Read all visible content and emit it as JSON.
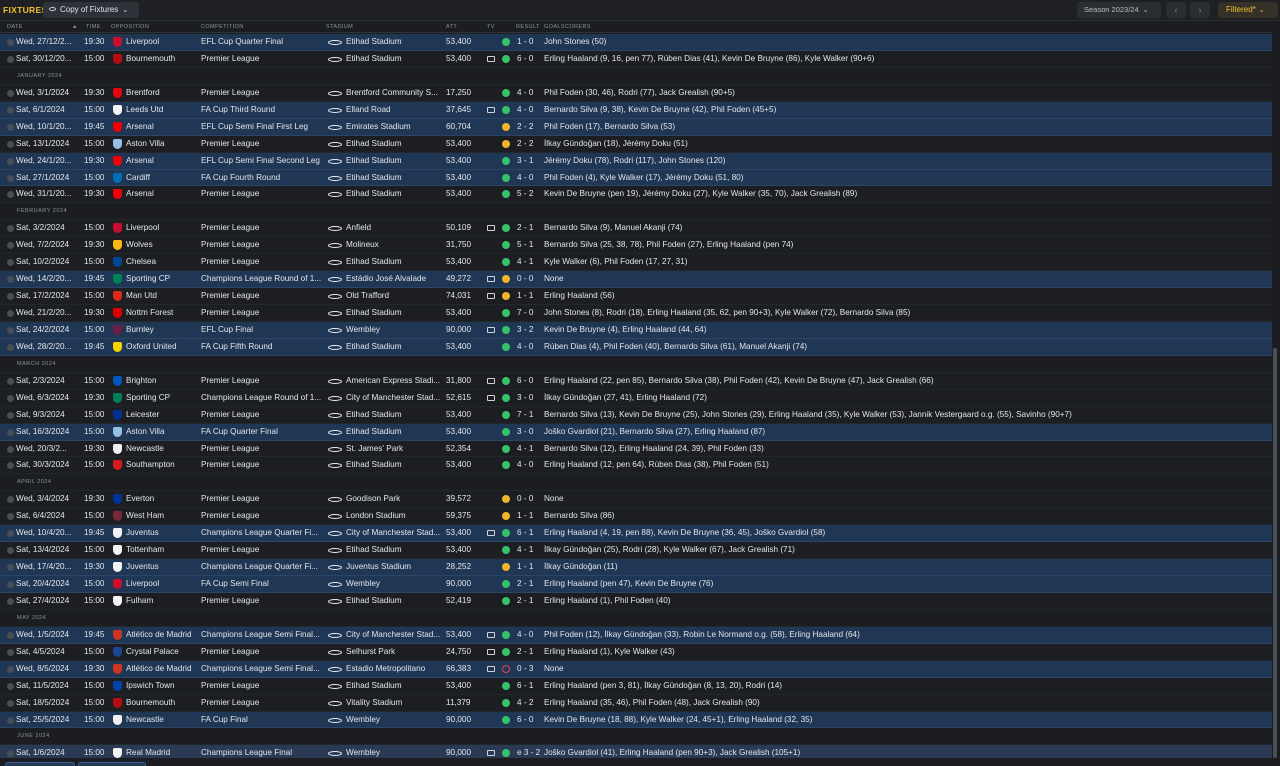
{
  "header": {
    "title": "FIXTURES",
    "view_label": "Copy of Fixtures",
    "season_label": "Season 2023/24",
    "filter_label": "Filtered*",
    "prev_icon": "chevron-left-icon",
    "next_icon": "chevron-right-icon"
  },
  "columns": {
    "date": "DATE",
    "time": "TIME",
    "opposition": "OPPOSITION",
    "competition": "COMPETITION",
    "stadium": "STADIUM",
    "att": "ATT",
    "tv": "TV",
    "result": "RESULT",
    "goalscorers": "GOALSCORERS"
  },
  "colors": {
    "accent": "#f0c030",
    "home_row": "#1f3654",
    "win": "#35c26a",
    "draw": "#f0b52c",
    "loss": "#e04848"
  },
  "rows": [
    {
      "kind": "fixture",
      "venue": "home",
      "date": "Wed, 27/12/2...",
      "time": "19:30",
      "opp": "Liverpool",
      "crest": "#c8102e",
      "comp": "EFL Cup Quarter Final",
      "stadium": "Etihad Stadium",
      "att": "53,400",
      "tv": false,
      "res": "w",
      "score": "1 - 0",
      "scorers": "John Stones (50)"
    },
    {
      "kind": "fixture",
      "venue": "away",
      "date": "Sat, 30/12/20...",
      "time": "15:00",
      "opp": "Bournemouth",
      "crest": "#b50e12",
      "comp": "Premier League",
      "stadium": "Etihad Stadium",
      "att": "53,400",
      "tv": true,
      "res": "w",
      "score": "6 - 0",
      "scorers": "Erling Haaland (9, 16, pen 77), Rúben Dias (41), Kevin De Bruyne (86), Kyle Walker (90+6)"
    },
    {
      "kind": "month",
      "label": "JANUARY 2024"
    },
    {
      "kind": "fixture",
      "venue": "away",
      "date": "Wed, 3/1/2024",
      "time": "19:30",
      "opp": "Brentford",
      "crest": "#e30613",
      "comp": "Premier League",
      "stadium": "Brentford Community S...",
      "att": "17,250",
      "tv": false,
      "res": "w",
      "score": "4 - 0",
      "scorers": "Phil Foden (30, 46), Rodri (77), Jack Grealish (90+5)"
    },
    {
      "kind": "fixture",
      "venue": "home",
      "date": "Sat, 6/1/2024",
      "time": "15:00",
      "opp": "Leeds Utd",
      "crest": "#f5f5f5",
      "comp": "FA Cup Third Round",
      "stadium": "Elland Road",
      "att": "37,645",
      "tv": true,
      "res": "w",
      "score": "4 - 0",
      "scorers": "Bernardo Silva (9, 38), Kevin De Bruyne (42), Phil Foden (45+5)"
    },
    {
      "kind": "fixture",
      "venue": "home",
      "date": "Wed, 10/1/20...",
      "time": "19:45",
      "opp": "Arsenal",
      "crest": "#ef0107",
      "comp": "EFL Cup Semi Final First Leg",
      "stadium": "Emirates Stadium",
      "att": "60,704",
      "tv": false,
      "res": "d",
      "score": "2 - 2",
      "scorers": "Phil Foden (17), Bernardo Silva (53)"
    },
    {
      "kind": "fixture",
      "venue": "away",
      "date": "Sat, 13/1/2024",
      "time": "15:00",
      "opp": "Aston Villa",
      "crest": "#95bfe5",
      "comp": "Premier League",
      "stadium": "Etihad Stadium",
      "att": "53,400",
      "tv": false,
      "res": "d",
      "score": "2 - 2",
      "scorers": "İlkay Gündoğan (18), Jérémy Doku (51)"
    },
    {
      "kind": "fixture",
      "venue": "home",
      "date": "Wed, 24/1/20...",
      "time": "19:30",
      "opp": "Arsenal",
      "crest": "#ef0107",
      "comp": "EFL Cup Semi Final Second Leg",
      "stadium": "Etihad Stadium",
      "att": "53,400",
      "tv": false,
      "res": "w",
      "score": "3 - 1",
      "scorers": "Jérémy Doku (78), Rodri (117), John Stones (120)"
    },
    {
      "kind": "fixture",
      "venue": "home",
      "date": "Sat, 27/1/2024",
      "time": "15:00",
      "opp": "Cardiff",
      "crest": "#0070b5",
      "comp": "FA Cup Fourth Round",
      "stadium": "Etihad Stadium",
      "att": "53,400",
      "tv": false,
      "res": "w",
      "score": "4 - 0",
      "scorers": "Phil Foden (4), Kyle Walker (17), Jérémy Doku (51, 80)"
    },
    {
      "kind": "fixture",
      "venue": "away",
      "date": "Wed, 31/1/20...",
      "time": "19:30",
      "opp": "Arsenal",
      "crest": "#ef0107",
      "comp": "Premier League",
      "stadium": "Etihad Stadium",
      "att": "53,400",
      "tv": false,
      "res": "w",
      "score": "5 - 2",
      "scorers": "Kevin De Bruyne (pen 19), Jérémy Doku (27), Kyle Walker (35, 70), Jack Grealish (89)"
    },
    {
      "kind": "month",
      "label": "FEBRUARY 2024"
    },
    {
      "kind": "fixture",
      "venue": "away",
      "date": "Sat, 3/2/2024",
      "time": "15:00",
      "opp": "Liverpool",
      "crest": "#c8102e",
      "comp": "Premier League",
      "stadium": "Anfield",
      "att": "50,109",
      "tv": true,
      "res": "w",
      "score": "2 - 1",
      "scorers": "Bernardo Silva (9), Manuel Akanji (74)"
    },
    {
      "kind": "fixture",
      "venue": "away",
      "date": "Wed, 7/2/2024",
      "time": "19:30",
      "opp": "Wolves",
      "crest": "#fdb913",
      "comp": "Premier League",
      "stadium": "Molineux",
      "att": "31,750",
      "tv": false,
      "res": "w",
      "score": "5 - 1",
      "scorers": "Bernardo Silva (25, 38, 78), Phil Foden (27), Erling Haaland (pen 74)"
    },
    {
      "kind": "fixture",
      "venue": "away",
      "date": "Sat, 10/2/2024",
      "time": "15:00",
      "opp": "Chelsea",
      "crest": "#034694",
      "comp": "Premier League",
      "stadium": "Etihad Stadium",
      "att": "53,400",
      "tv": false,
      "res": "w",
      "score": "4 - 1",
      "scorers": "Kyle Walker (6), Phil Foden (17, 27, 31)"
    },
    {
      "kind": "fixture",
      "venue": "home",
      "date": "Wed, 14/2/20...",
      "time": "19:45",
      "opp": "Sporting CP",
      "crest": "#008057",
      "comp": "Champions League Round of 1...",
      "stadium": "Estádio José Alvalade",
      "att": "49,272",
      "tv": true,
      "res": "d",
      "score": "0 - 0",
      "scorers": "None"
    },
    {
      "kind": "fixture",
      "venue": "away",
      "date": "Sat, 17/2/2024",
      "time": "15:00",
      "opp": "Man Utd",
      "crest": "#da291c",
      "comp": "Premier League",
      "stadium": "Old Trafford",
      "att": "74,031",
      "tv": true,
      "res": "d",
      "score": "1 - 1",
      "scorers": "Erling Haaland (56)"
    },
    {
      "kind": "fixture",
      "venue": "away",
      "date": "Wed, 21/2/20...",
      "time": "19:30",
      "opp": "Nottm Forest",
      "crest": "#dd0000",
      "comp": "Premier League",
      "stadium": "Etihad Stadium",
      "att": "53,400",
      "tv": false,
      "res": "w",
      "score": "7 - 0",
      "scorers": "John Stones (8), Rodri (18), Erling Haaland (35, 62, pen 90+3), Kyle Walker (72), Bernardo Silva (85)"
    },
    {
      "kind": "fixture",
      "venue": "home",
      "date": "Sat, 24/2/2024",
      "time": "15:00",
      "opp": "Burnley",
      "crest": "#6c1d45",
      "comp": "EFL Cup Final",
      "stadium": "Wembley",
      "att": "90,000",
      "tv": true,
      "res": "w",
      "score": "3 - 2",
      "scorers": "Kevin De Bruyne (4), Erling Haaland (44, 64)"
    },
    {
      "kind": "fixture",
      "venue": "home",
      "date": "Wed, 28/2/20...",
      "time": "19:45",
      "opp": "Oxford United",
      "crest": "#f5d400",
      "comp": "FA Cup Fifth Round",
      "stadium": "Etihad Stadium",
      "att": "53,400",
      "tv": false,
      "res": "w",
      "score": "4 - 0",
      "scorers": "Rúben Dias (4), Phil Foden (40), Bernardo Silva (61), Manuel Akanji (74)"
    },
    {
      "kind": "month",
      "label": "MARCH 2024"
    },
    {
      "kind": "fixture",
      "venue": "away",
      "date": "Sat, 2/3/2024",
      "time": "15:00",
      "opp": "Brighton",
      "crest": "#0057b8",
      "comp": "Premier League",
      "stadium": "American Express Stadi...",
      "att": "31,800",
      "tv": true,
      "res": "w",
      "score": "6 - 0",
      "scorers": "Erling Haaland (22, pen 85), Bernardo Silva (38), Phil Foden (42), Kevin De Bruyne (47), Jack Grealish (66)"
    },
    {
      "kind": "fixture",
      "venue": "away",
      "date": "Wed, 6/3/2024",
      "time": "19:30",
      "opp": "Sporting CP",
      "crest": "#008057",
      "comp": "Champions League Round of 1...",
      "stadium": "City of Manchester Stad...",
      "att": "52,615",
      "tv": true,
      "res": "w",
      "score": "3 - 0",
      "scorers": "İlkay Gündoğan (27, 41), Erling Haaland (72)"
    },
    {
      "kind": "fixture",
      "venue": "away",
      "date": "Sat, 9/3/2024",
      "time": "15:00",
      "opp": "Leicester",
      "crest": "#003090",
      "comp": "Premier League",
      "stadium": "Etihad Stadium",
      "att": "53,400",
      "tv": false,
      "res": "w",
      "score": "7 - 1",
      "scorers": "Bernardo Silva (13), Kevin De Bruyne (25), John Stones (29), Erling Haaland (35), Kyle Walker (53), Jannik Vestergaard o.g. (55), Savinho (90+7)"
    },
    {
      "kind": "fixture",
      "venue": "home",
      "date": "Sat, 16/3/2024",
      "time": "15:00",
      "opp": "Aston Villa",
      "crest": "#95bfe5",
      "comp": "FA Cup Quarter Final",
      "stadium": "Etihad Stadium",
      "att": "53,400",
      "tv": false,
      "res": "w",
      "score": "3 - 0",
      "scorers": "Joško Gvardiol (21), Bernardo Silva (27), Erling Haaland (87)"
    },
    {
      "kind": "fixture",
      "venue": "away",
      "date": "Wed, 20/3/2...",
      "time": "19:30",
      "opp": "Newcastle",
      "crest": "#f0f0f0",
      "comp": "Premier League",
      "stadium": "St. James' Park",
      "att": "52,354",
      "tv": false,
      "res": "w",
      "score": "4 - 1",
      "scorers": "Bernardo Silva (12), Erling Haaland (24, 39), Phil Foden (33)"
    },
    {
      "kind": "fixture",
      "venue": "away",
      "date": "Sat, 30/3/2024",
      "time": "15:00",
      "opp": "Southampton",
      "crest": "#d71920",
      "comp": "Premier League",
      "stadium": "Etihad Stadium",
      "att": "53,400",
      "tv": false,
      "res": "w",
      "score": "4 - 0",
      "scorers": "Erling Haaland (12, pen 64), Rúben Dias (38), Phil Foden (51)"
    },
    {
      "kind": "month",
      "label": "APRIL 2024"
    },
    {
      "kind": "fixture",
      "venue": "away",
      "date": "Wed, 3/4/2024",
      "time": "19:30",
      "opp": "Everton",
      "crest": "#003399",
      "comp": "Premier League",
      "stadium": "Goodison Park",
      "att": "39,572",
      "tv": false,
      "res": "d",
      "score": "0 - 0",
      "scorers": "None"
    },
    {
      "kind": "fixture",
      "venue": "away",
      "date": "Sat, 6/4/2024",
      "time": "15:00",
      "opp": "West Ham",
      "crest": "#7a263a",
      "comp": "Premier League",
      "stadium": "London Stadium",
      "att": "59,375",
      "tv": false,
      "res": "d",
      "score": "1 - 1",
      "scorers": "Bernardo Silva (86)"
    },
    {
      "kind": "fixture",
      "venue": "home",
      "date": "Wed, 10/4/20...",
      "time": "19:45",
      "opp": "Juventus",
      "crest": "#f2f2f2",
      "comp": "Champions League Quarter Fi...",
      "stadium": "City of Manchester Stad...",
      "att": "53,400",
      "tv": true,
      "res": "w",
      "score": "6 - 1",
      "scorers": "Erling Haaland (4, 19, pen 88), Kevin De Bruyne (36, 45), Joško Gvardiol (58)"
    },
    {
      "kind": "fixture",
      "venue": "away",
      "date": "Sat, 13/4/2024",
      "time": "15:00",
      "opp": "Tottenham",
      "crest": "#f2f2f2",
      "comp": "Premier League",
      "stadium": "Etihad Stadium",
      "att": "53,400",
      "tv": false,
      "res": "w",
      "score": "4 - 1",
      "scorers": "İlkay Gündoğan (25), Rodri (28), Kyle Walker (67), Jack Grealish (71)"
    },
    {
      "kind": "fixture",
      "venue": "home",
      "date": "Wed, 17/4/20...",
      "time": "19:30",
      "opp": "Juventus",
      "crest": "#f2f2f2",
      "comp": "Champions League Quarter Fi...",
      "stadium": "Juventus Stadium",
      "att": "28,252",
      "tv": false,
      "res": "d",
      "score": "1 - 1",
      "scorers": "İlkay Gündoğan (11)"
    },
    {
      "kind": "fixture",
      "venue": "home",
      "date": "Sat, 20/4/2024",
      "time": "15:00",
      "opp": "Liverpool",
      "crest": "#c8102e",
      "comp": "FA Cup Semi Final",
      "stadium": "Wembley",
      "att": "90,000",
      "tv": false,
      "res": "w",
      "score": "2 - 1",
      "scorers": "Erling Haaland (pen 47), Kevin De Bruyne (76)"
    },
    {
      "kind": "fixture",
      "venue": "away",
      "date": "Sat, 27/4/2024",
      "time": "15:00",
      "opp": "Fulham",
      "crest": "#f2f2f2",
      "comp": "Premier League",
      "stadium": "Etihad Stadium",
      "att": "52,419",
      "tv": false,
      "res": "w",
      "score": "2 - 1",
      "scorers": "Erling Haaland (1), Phil Foden (40)"
    },
    {
      "kind": "month",
      "label": "MAY 2024"
    },
    {
      "kind": "fixture",
      "venue": "home",
      "date": "Wed, 1/5/2024",
      "time": "19:45",
      "opp": "Atlético de Madrid",
      "crest": "#cb3524",
      "comp": "Champions League Semi Final...",
      "stadium": "City of Manchester Stad...",
      "att": "53,400",
      "tv": true,
      "res": "w",
      "score": "4 - 0",
      "scorers": "Phil Foden (12), İlkay Gündoğan (33), Robin Le Normand o.g. (58), Erling Haaland (64)"
    },
    {
      "kind": "fixture",
      "venue": "away",
      "date": "Sat, 4/5/2024",
      "time": "15:00",
      "opp": "Crystal Palace",
      "crest": "#1b458f",
      "comp": "Premier League",
      "stadium": "Selhurst Park",
      "att": "24,750",
      "tv": true,
      "res": "w",
      "score": "2 - 1",
      "scorers": "Erling Haaland (1), Kyle Walker (43)"
    },
    {
      "kind": "fixture",
      "venue": "home",
      "date": "Wed, 8/5/2024",
      "time": "19:30",
      "opp": "Atlético de Madrid",
      "crest": "#cb3524",
      "comp": "Champions League Semi Final...",
      "stadium": "Estadio Metropolitano",
      "att": "66,383",
      "tv": true,
      "res": "l",
      "score": "0 - 3",
      "scorers": "None"
    },
    {
      "kind": "fixture",
      "venue": "away",
      "date": "Sat, 11/5/2024",
      "time": "15:00",
      "opp": "Ipswich Town",
      "crest": "#0044a9",
      "comp": "Premier League",
      "stadium": "Etihad Stadium",
      "att": "53,400",
      "tv": false,
      "res": "w",
      "score": "6 - 1",
      "scorers": "Erling Haaland (pen 3, 81), İlkay Gündoğan (8, 13, 20), Rodri (14)"
    },
    {
      "kind": "fixture",
      "venue": "away",
      "date": "Sat, 18/5/2024",
      "time": "15:00",
      "opp": "Bournemouth",
      "crest": "#b50e12",
      "comp": "Premier League",
      "stadium": "Vitality Stadium",
      "att": "11,379",
      "tv": false,
      "res": "w",
      "score": "4 - 2",
      "scorers": "Erling Haaland (35, 46), Phil Foden (48), Jack Grealish (90)"
    },
    {
      "kind": "fixture",
      "venue": "home",
      "date": "Sat, 25/5/2024",
      "time": "15:00",
      "opp": "Newcastle",
      "crest": "#f0f0f0",
      "comp": "FA Cup Final",
      "stadium": "Wembley",
      "att": "90,000",
      "tv": false,
      "res": "w",
      "score": "6 - 0",
      "scorers": "Kevin De Bruyne (18, 88), Kyle Walker (24, 45+1), Erling Haaland (32, 35)"
    },
    {
      "kind": "month",
      "label": "JUNE 2024"
    },
    {
      "kind": "fixture",
      "venue": "hl",
      "date": "Sat, 1/6/2024",
      "time": "15:00",
      "opp": "Real Madrid",
      "crest": "#f2f2f2",
      "comp": "Champions League Final",
      "stadium": "Wembley",
      "att": "90,000",
      "tv": true,
      "res": "w",
      "score": "e 3 - 2",
      "scorers": "Joško Gvardiol (41), Erling Haaland (pen 90+3), Jack Grealish (105+1)"
    }
  ]
}
